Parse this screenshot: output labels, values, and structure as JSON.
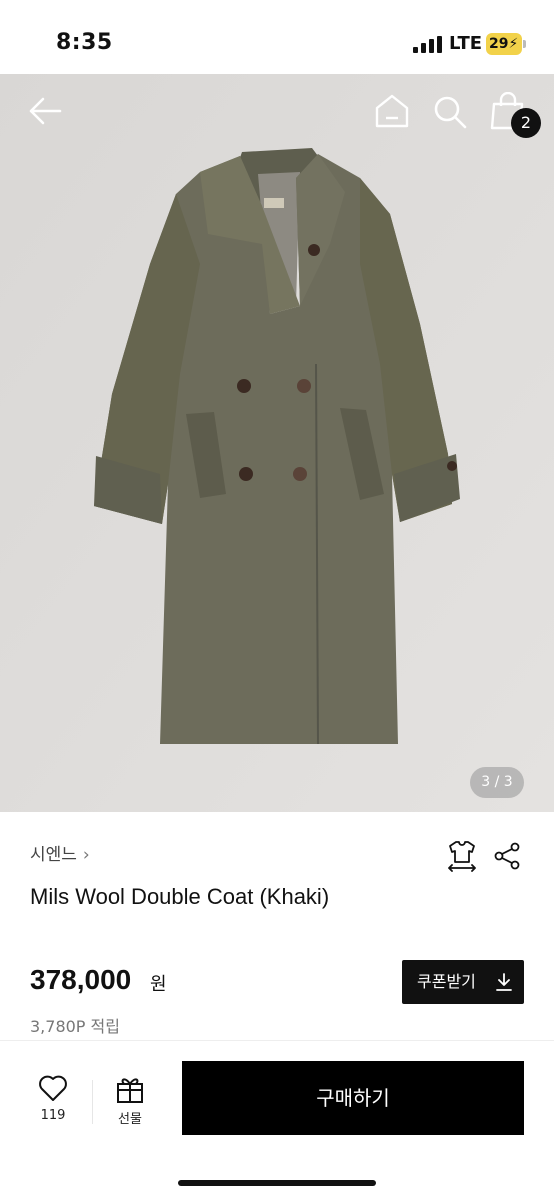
{
  "status_bar": {
    "time": "8:35",
    "network": "LTE",
    "battery": "29"
  },
  "top_nav": {
    "back_icon": "arrow-left-icon",
    "home_icon": "home-icon",
    "search_icon": "search-icon",
    "cart_icon": "shopping-bag-icon",
    "cart_count": "2"
  },
  "gallery": {
    "indicator": "3 / 3",
    "image_colors": {
      "background": "#e0dedc",
      "coat": "#6b6b5a"
    }
  },
  "product": {
    "brand": "시엔느",
    "title": "Mils Wool Double Coat (Khaki)",
    "size_icon": "size-guide-icon",
    "share_icon": "share-icon",
    "price": "378,000",
    "currency": "원",
    "points": "3,780P 적립",
    "coupon_label": "쿠폰받기"
  },
  "bottom_bar": {
    "like_count": "119",
    "gift_label": "선물",
    "buy_label": "구매하기"
  }
}
